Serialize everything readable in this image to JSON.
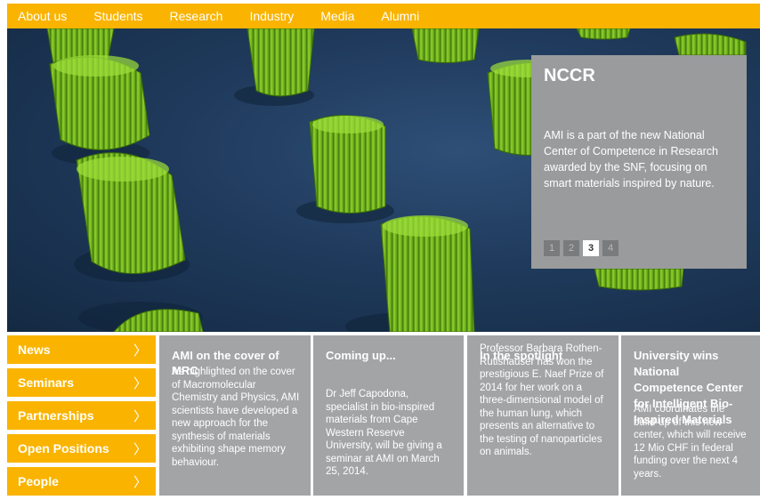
{
  "nav": {
    "items": [
      "About us",
      "Students",
      "Research",
      "Industry",
      "Media",
      "Alumni"
    ]
  },
  "hero": {
    "panel_title": "NCCR",
    "panel_text": "AMI is a part of the new National Center of Competence in Research awarded by the SNF, focusing on smart materials inspired by nature.",
    "pages": [
      "1",
      "2",
      "3",
      "4"
    ],
    "active_page": "3"
  },
  "side_menu": {
    "items": [
      "News",
      "Seminars",
      "Partnerships",
      "Open Positions",
      "People"
    ],
    "chevron": "〉"
  },
  "cards": [
    {
      "title": "AMI on the cover of MRC",
      "text": "As highlighted on the cover of Macromolecular Chemistry and Physics, AMI scientists have developed a new approach for the synthesis of materials exhibiting shape memory behaviour."
    },
    {
      "title": "Coming up...",
      "text": "Dr Jeff Capodona, specialist in bio-inspired materials from Cape Western Reserve University, will be giving a seminar at AMI on March 25, 2014."
    },
    {
      "title": "In the spotlight",
      "text": "Professor Barbara Rothen-Rutishauser has won the prestigious E. Naef Prize of 2014 for her work on a three-dimensional model of the human lung, which presents an alternative to the testing of nanoparticles on animals."
    },
    {
      "title": "University wins National Competence Center for Intelligent Bio-Inspired Materials",
      "text": "AMI coordinates the build-up of this new center, which will receive 12 Mio CHF in federal funding over the next 4 years."
    }
  ],
  "colors": {
    "accent": "#fab400",
    "panel_gray": "#9a9b9d",
    "card_gray": "#a3a4a6",
    "pillar_green": "#7fc222"
  }
}
